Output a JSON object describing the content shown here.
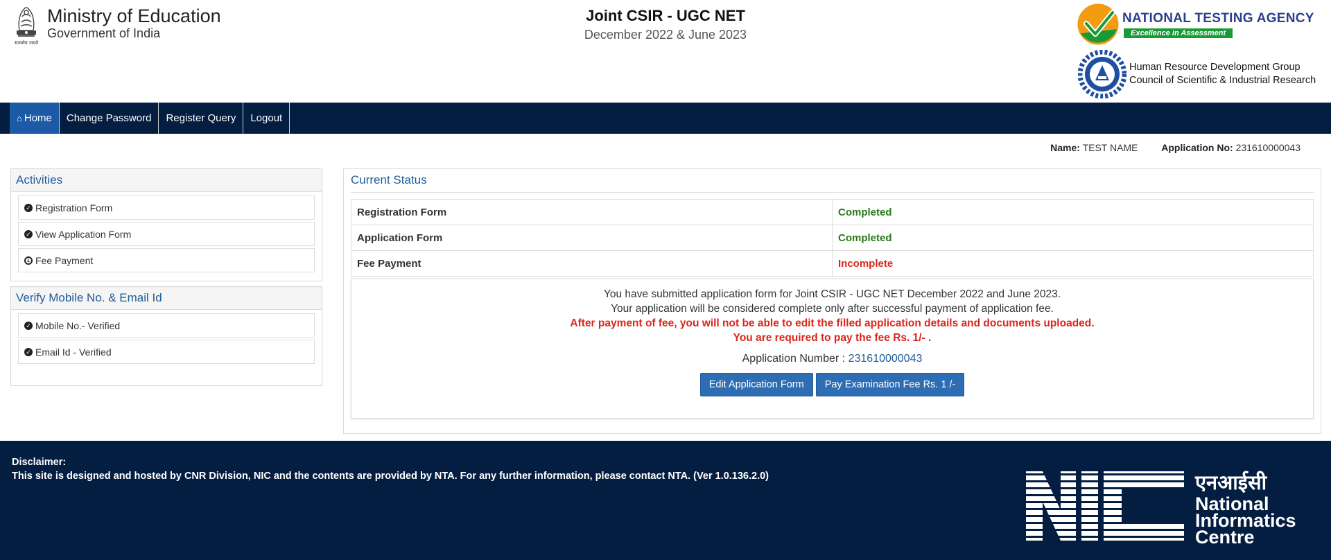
{
  "header": {
    "ministry_title": "Ministry of Education",
    "ministry_subtitle": "Government of India",
    "exam_title": "Joint CSIR - UGC NET",
    "exam_subtitle": "December 2022 & June 2023",
    "nta_name": "NATIONAL TESTING AGENCY",
    "nta_tagline": "Excellence in Assessment",
    "csir_line1": "Human Resource Development Group",
    "csir_line2": "Council of Scientific & Industrial Research"
  },
  "nav": {
    "items": [
      {
        "label": "Home",
        "icon": "home-icon"
      },
      {
        "label": "Change Password"
      },
      {
        "label": "Register Query"
      },
      {
        "label": "Logout"
      }
    ]
  },
  "user": {
    "name_label": "Name:",
    "name_value": "TEST NAME",
    "appno_label": "Application No:",
    "appno_value": "231610000043"
  },
  "activities": {
    "title": "Activities",
    "items": [
      {
        "label": "Registration Form",
        "icon": "check-circle-icon"
      },
      {
        "label": "View Application Form",
        "icon": "check-circle-icon"
      },
      {
        "label": "Fee Payment",
        "icon": "clock-circle-icon"
      }
    ]
  },
  "verify": {
    "title": "Verify Mobile No. & Email Id",
    "items": [
      {
        "label": "Mobile No.- Verified",
        "icon": "check-circle-icon"
      },
      {
        "label": "Email Id - Verified",
        "icon": "check-circle-icon"
      }
    ]
  },
  "status": {
    "title": "Current Status",
    "rows": [
      {
        "label": "Registration Form",
        "value": "Completed",
        "state": "ok"
      },
      {
        "label": "Application Form",
        "value": "Completed",
        "state": "ok"
      },
      {
        "label": "Fee Payment",
        "value": "Incomplete",
        "state": "bad"
      }
    ],
    "notice_line1": "You have submitted application form for Joint CSIR - UGC NET December 2022 and June 2023.",
    "notice_line2": "Your application will be considered complete only after successful payment of application fee.",
    "notice_warning1": "After payment of fee, you will not be able to edit the filled application details and documents uploaded.",
    "notice_warning2": "You are required to pay the fee Rs. 1/- .",
    "appno_label": "Application Number :",
    "appno_value": "231610000043",
    "edit_button": "Edit Application Form",
    "pay_button": "Pay Examination Fee Rs. 1 /-"
  },
  "footer": {
    "disclaimer_label": "Disclaimer:",
    "disclaimer_text": "This site is designed and hosted by CNR Division, NIC and the contents are provided by NTA. For any further information, please contact NTA. (Ver 1.0.136.2.0)",
    "nic_hindi": "एनआईसी",
    "nic_line1": "National",
    "nic_line2": "Informatics",
    "nic_line3": "Centre"
  },
  "colors": {
    "navy": "#041e42",
    "nav_active": "#1c5aa8",
    "panel_title": "#1f5c99",
    "completed": "#2a7a1a",
    "incomplete": "#d9261c",
    "button": "#2d6db4",
    "nta_blue": "#2b3e8e",
    "nta_green": "#1a9a36",
    "nta_orange": "#f39c12"
  }
}
